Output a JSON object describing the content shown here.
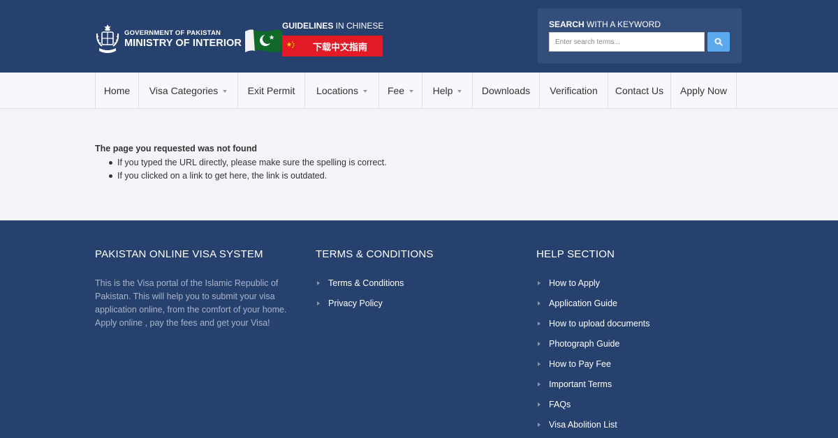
{
  "header": {
    "logo": {
      "line1": "GOVERNMENT OF PAKISTAN",
      "line2": "MINISTRY OF INTERIOR"
    },
    "guidelines": {
      "title_bold": "GUIDELINES",
      "title_rest": " IN CHINESE",
      "button_label": "下载中文指南"
    },
    "search": {
      "title_bold": "SEARCH",
      "title_rest": " WITH A KEYWORD",
      "placeholder": "Enter search terms...",
      "value": ""
    }
  },
  "nav": {
    "items": [
      {
        "label": "Home",
        "dropdown": false
      },
      {
        "label": "Visa Categories",
        "dropdown": true
      },
      {
        "label": "Exit Permit",
        "dropdown": false
      },
      {
        "label": "Locations",
        "dropdown": true
      },
      {
        "label": "Fee",
        "dropdown": true
      },
      {
        "label": "Help",
        "dropdown": true
      },
      {
        "label": "Downloads",
        "dropdown": false
      },
      {
        "label": "Verification",
        "dropdown": false
      },
      {
        "label": "Contact Us",
        "dropdown": false
      },
      {
        "label": "Apply Now",
        "dropdown": false
      }
    ]
  },
  "main": {
    "error_title": "The page you requested was not found",
    "error_items": [
      "If you typed the URL directly, please make sure the spelling is correct.",
      "If you clicked on a link to get here, the link is outdated."
    ]
  },
  "footer": {
    "about": {
      "title": "PAKISTAN ONLINE VISA SYSTEM",
      "text": "This is the Visa portal of the Islamic Republic of Pakistan. This will help you to submit your visa application online, from the comfort of your home. Apply online , pay the fees and get your Visa!"
    },
    "terms": {
      "title": "TERMS & CONDITIONS",
      "links": [
        "Terms & Conditions",
        "Privacy Policy"
      ]
    },
    "help": {
      "title": "HELP SECTION",
      "links": [
        "How to Apply",
        "Application Guide",
        "How to upload documents",
        "Photograph Guide",
        "How to Pay Fee",
        "Important Terms",
        "FAQs",
        "Visa Abolition List"
      ]
    }
  },
  "colors": {
    "header_bg": "#27416f",
    "search_panel_bg": "#344e7c",
    "search_button": "#5aa9ec",
    "chinese_button": "#e21a26",
    "nav_bg": "#f7f8fb",
    "body_bg": "#f3f4f8"
  }
}
